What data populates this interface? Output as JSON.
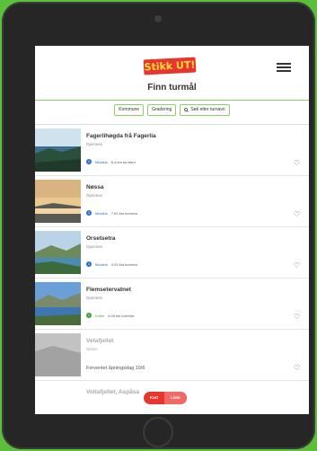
{
  "header": {
    "logo_text": "Stikk UT!",
    "title": "Finn turmål"
  },
  "filters": [
    {
      "label": "Kommune"
    },
    {
      "label": "Gradering"
    },
    {
      "label": "Søk etter turnavn"
    }
  ],
  "items": [
    {
      "name": "Fagerlihøgda frå Fagerlia",
      "location": "Gjemnes",
      "difficulty": "Middels",
      "distance": "6,4 km tur/retur",
      "badge_color": "#2f6fd1"
    },
    {
      "name": "Nøssa",
      "location": "Gjemnes",
      "difficulty": "Middels",
      "distance": "7,61 km tur/retur",
      "badge_color": "#2f6fd1"
    },
    {
      "name": "Orsetsetra",
      "location": "Gjemnes",
      "difficulty": "Middels",
      "distance": "3,93 km tur/retur",
      "badge_color": "#2f6fd1"
    },
    {
      "name": "Flemsetervatnet",
      "location": "Gjemnes",
      "difficulty": "Enkel",
      "distance": "4,05 km tur/retur",
      "badge_color": "#3ea33b"
    },
    {
      "name": "Vetafjellet",
      "location": "Nesse",
      "note": "Forventet åpningsdag 10/6"
    },
    {
      "name": "Vettafjellet, Aspåsa"
    }
  ],
  "tabs": {
    "map": "Kart",
    "list": "Liste"
  },
  "colors": {
    "brand_red": "#e8352e",
    "accent_green": "#5cbf3a"
  }
}
